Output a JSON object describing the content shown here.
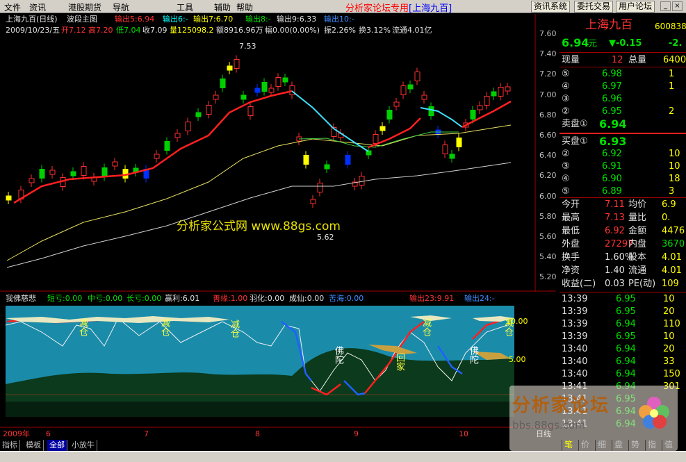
{
  "menu": {
    "items": [
      "文件",
      "资讯",
      "港股期货",
      "导航",
      "工具",
      "辅助",
      "帮助"
    ],
    "promo": "分析家论坛专用",
    "promo_stock": "[上海九百]",
    "buttons": [
      "资讯系统",
      "委托交易",
      "用户论坛"
    ]
  },
  "header": {
    "line1": {
      "title": "上海九百(日线)",
      "indicator": "波段主图",
      "o1": "输出5:6.94",
      "o2": "输出6:-",
      "o3": "输出7:6.70",
      "o4": "输出8:-",
      "o5": "输出9:6.33",
      "o6": "输出10:-"
    },
    "line2": {
      "date": "2009/10/23/五",
      "open": "开7.12",
      "high": "高7.20",
      "low": "低7.04",
      "close": "收7.09",
      "vol": "量125098.2",
      "amt": "额8916.96万",
      "fu": "幅0.00(0.00%)",
      "zhen": "振2.26%",
      "huan": "换3.12%",
      "liutong": "流通4.01亿"
    }
  },
  "main_chart": {
    "peak_label": "7.53",
    "low_label": "5.62",
    "watermark": "分析家公式网 www.88gs.com",
    "yaxis": [
      "7.60",
      "7.40",
      "7.20",
      "7.00",
      "6.80",
      "6.60",
      "6.40",
      "6.20",
      "6.00",
      "5.80",
      "5.60",
      "5.40",
      "5.20"
    ]
  },
  "sub_chart": {
    "title": "我佛慈悲",
    "short": "短亏:0.00",
    "mid": "中亏:0.00",
    "long": "长亏:0.00",
    "win": "赢利:6.01",
    "shanyuan": "善缘:1.00",
    "yuhua": "羽化:0.00",
    "chengxian": "成仙:0.00",
    "kuhai": "苦海:0.00",
    "o23": "输出23:9.91",
    "o24": "输出24:-",
    "yaxis": [
      "10.00",
      "5.00"
    ],
    "markers": [
      "减仓",
      "减仓",
      "减仓",
      "减仓",
      "减仓",
      "佛陀",
      "佛陀",
      "回家"
    ]
  },
  "xaxis": {
    "labels": [
      "2009年",
      "6",
      "7",
      "8",
      "9",
      "10"
    ],
    "period": "日线"
  },
  "bottom_tabs": [
    "指标",
    "模板",
    "全部",
    "小放牛"
  ],
  "right_panel": {
    "name": "上海九百",
    "code": "600838",
    "price": "6.94",
    "unit": "元",
    "change": "▼-0.15",
    "pct": "-2.",
    "xianliang_label": "现量",
    "xianliang": "12",
    "zongliang_label": "总量",
    "zongliang": "6400",
    "sells": [
      {
        "l": "⑤",
        "p": "6.98",
        "v": "1"
      },
      {
        "l": "④",
        "p": "6.97",
        "v": "1"
      },
      {
        "l": "③",
        "p": "6.96",
        "v": ""
      },
      {
        "l": "②",
        "p": "6.95",
        "v": "2"
      },
      {
        "l": "卖盘①",
        "p": "6.94",
        "v": ""
      }
    ],
    "buys": [
      {
        "l": "买盘①",
        "p": "6.93",
        "v": ""
      },
      {
        "l": "②",
        "p": "6.92",
        "v": "10"
      },
      {
        "l": "③",
        "p": "6.91",
        "v": "10"
      },
      {
        "l": "④",
        "p": "6.90",
        "v": "18"
      },
      {
        "l": "⑤",
        "p": "6.89",
        "v": "3"
      }
    ],
    "stats": [
      {
        "a": "今开",
        "av": "7.11",
        "b": "均价",
        "bv": "6.9"
      },
      {
        "a": "最高",
        "av": "7.13",
        "b": "量比",
        "bv": "0."
      },
      {
        "a": "最低",
        "av": "6.92",
        "b": "金额",
        "bv": "4476"
      },
      {
        "a": "外盘",
        "av": "27297",
        "b": "内盘",
        "bv": "3670"
      },
      {
        "a": "换手",
        "av": "1.60%",
        "b": "股本",
        "bv": "4.01"
      },
      {
        "a": "净资",
        "av": "1.40",
        "b": "流通",
        "bv": "4.01"
      },
      {
        "a": "收益(二)",
        "av": "0.03",
        "b": "PE(动)",
        "bv": "109"
      }
    ],
    "ticks": [
      {
        "t": "13:39",
        "p": "6.95",
        "v": "10"
      },
      {
        "t": "13:39",
        "p": "6.95",
        "v": "20"
      },
      {
        "t": "13:39",
        "p": "6.94",
        "v": "110"
      },
      {
        "t": "13:39",
        "p": "6.95",
        "v": "10"
      },
      {
        "t": "13:40",
        "p": "6.94",
        "v": "20"
      },
      {
        "t": "13:40",
        "p": "6.94",
        "v": "33"
      },
      {
        "t": "13:40",
        "p": "6.94",
        "v": "150"
      },
      {
        "t": "13:41",
        "p": "6.94",
        "v": "301"
      },
      {
        "t": "13:41",
        "p": "6.95",
        "v": ""
      },
      {
        "t": "13:41",
        "p": "6.94",
        "v": ""
      },
      {
        "t": "13:41",
        "p": "6.94",
        "v": ""
      }
    ],
    "tabs": [
      "笔",
      "价",
      "细",
      "盘",
      "势",
      "指",
      "值"
    ],
    "forum_logo": "分析家论坛",
    "forum_url": "bbs.88gs.com"
  }
}
